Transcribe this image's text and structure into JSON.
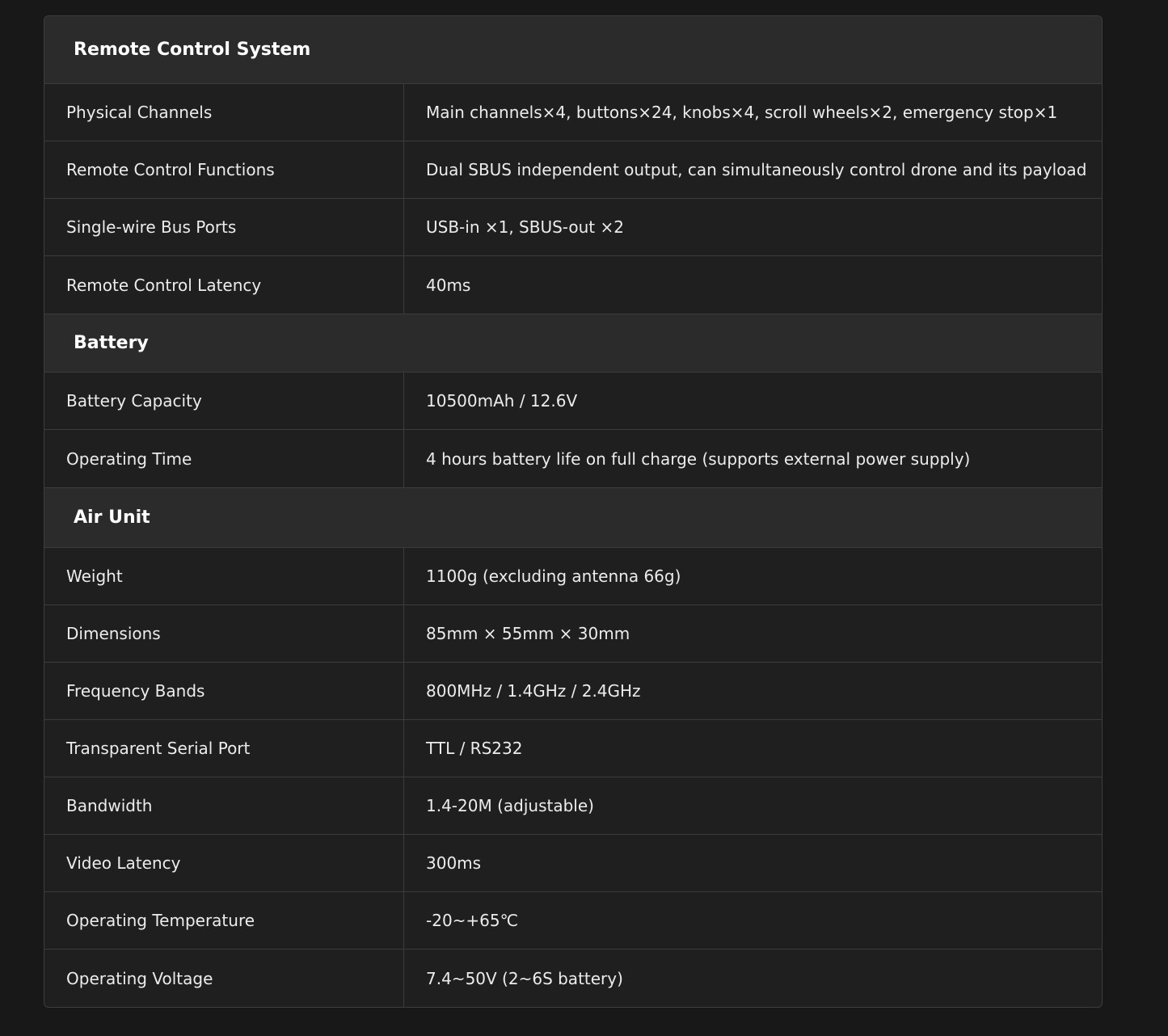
{
  "sections": [
    {
      "title": "Remote Control System",
      "rows": [
        {
          "label": "Physical Channels",
          "value": "Main channels×4, buttons×24, knobs×4, scroll wheels×2, emergency stop×1"
        },
        {
          "label": "Remote Control Functions",
          "value": "Dual SBUS independent output, can simultaneously control drone and its payload"
        },
        {
          "label": "Single-wire Bus Ports",
          "value": "USB-in ×1, SBUS-out ×2"
        },
        {
          "label": "Remote Control Latency",
          "value": "40ms"
        }
      ]
    },
    {
      "title": "Battery",
      "rows": [
        {
          "label": "Battery Capacity",
          "value": "10500mAh / 12.6V"
        },
        {
          "label": "Operating Time",
          "value": "4 hours battery life on full charge (supports external power supply)"
        }
      ]
    },
    {
      "title": "Air Unit",
      "rows": [
        {
          "label": "Weight",
          "value": "1100g (excluding antenna 66g)"
        },
        {
          "label": "Dimensions",
          "value": "85mm × 55mm × 30mm"
        },
        {
          "label": "Frequency Bands",
          "value": "800MHz / 1.4GHz / 2.4GHz"
        },
        {
          "label": "Transparent Serial Port",
          "value": "TTL / RS232"
        },
        {
          "label": "Bandwidth",
          "value": "1.4-20M (adjustable)"
        },
        {
          "label": "Video Latency",
          "value": "300ms"
        },
        {
          "label": "Operating Temperature",
          "value": "-20~+65℃"
        },
        {
          "label": "Operating Voltage",
          "value": "7.4~50V (2~6S battery)"
        }
      ]
    }
  ]
}
